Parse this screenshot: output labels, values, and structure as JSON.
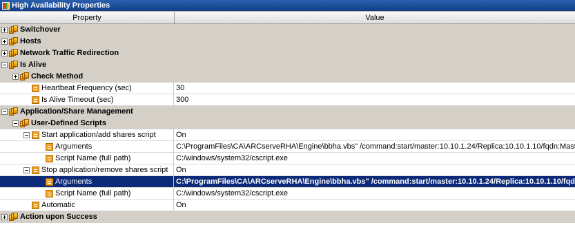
{
  "window": {
    "title": "High Availability Properties",
    "icon": "properties-icon"
  },
  "columns": {
    "property": "Property",
    "value": "Value"
  },
  "rows": [
    {
      "type": "group",
      "label": "Switchover",
      "value": "",
      "expander": "plus",
      "indent": 0
    },
    {
      "type": "group",
      "label": "Hosts",
      "value": "",
      "expander": "plus",
      "indent": 0
    },
    {
      "type": "group",
      "label": "Network Traffic Redirection",
      "value": "",
      "expander": "plus",
      "indent": 0
    },
    {
      "type": "group",
      "label": "Is Alive",
      "value": "",
      "expander": "minus",
      "indent": 0
    },
    {
      "type": "group",
      "label": "Check Method",
      "value": "",
      "expander": "plus",
      "indent": 1
    },
    {
      "type": "item",
      "label": "Heartbeat Frequency (sec)",
      "value": "30",
      "expander": "none",
      "indent": 1
    },
    {
      "type": "item",
      "label": "Is Alive Timeout (sec)",
      "value": "300",
      "expander": "none",
      "indent": 1
    },
    {
      "type": "group",
      "label": "Application/Share Management",
      "value": "",
      "expander": "minus",
      "indent": 0
    },
    {
      "type": "group",
      "label": "User-Defined Scripts",
      "value": "",
      "expander": "minus",
      "indent": 1
    },
    {
      "type": "item",
      "label": "Start application/add shares script",
      "value": "On",
      "expander": "minus",
      "indent": 2
    },
    {
      "type": "item",
      "label": "Arguments",
      "value": "C:\\ProgramFiles\\CA\\ARCserveRHA\\Engine\\bbha.vbs\" /command:start/master:10.10.1.24/Replica:10.10.1.10/fqdn:Master.rha.lab",
      "expander": "none",
      "indent": 3
    },
    {
      "type": "item",
      "label": "Script Name (full path)",
      "value": "C:/windows/system32/cscript.exe",
      "expander": "none",
      "indent": 3
    },
    {
      "type": "item",
      "label": "Stop application/remove shares script",
      "value": "On",
      "expander": "minus",
      "indent": 2
    },
    {
      "type": "item",
      "label": "Arguments",
      "value": "C:\\ProgramFiles\\CA\\ARCserveRHA\\Engine\\bbha.vbs\" /command:start/master:10.10.1.24/Replica:10.10.1.10/fqdn:Master.rha.lab",
      "expander": "none",
      "indent": 3,
      "selected": true
    },
    {
      "type": "item",
      "label": "Script Name (full path)",
      "value": "C:/windows/system32/cscript.exe",
      "expander": "none",
      "indent": 3
    },
    {
      "type": "item",
      "label": "Automatic",
      "value": "On",
      "expander": "none",
      "indent": 1
    },
    {
      "type": "group",
      "label": "Action upon Success",
      "value": "",
      "expander": "plus",
      "indent": 0
    }
  ],
  "colors": {
    "titlebar": "#1b4e9b",
    "group_row": "#d4d0c8",
    "selection": "#0c2a78"
  }
}
